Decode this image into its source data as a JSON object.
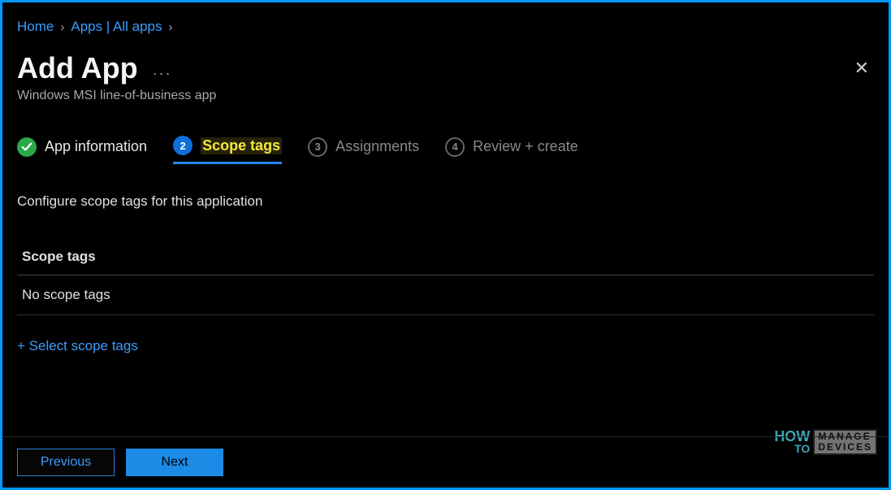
{
  "breadcrumb": {
    "home": "Home",
    "apps": "Apps | All apps"
  },
  "page": {
    "title": "Add App",
    "subtitle": "Windows MSI line-of-business app"
  },
  "steps": {
    "s1": {
      "label": "App information"
    },
    "s2": {
      "num": "2",
      "label": "Scope tags"
    },
    "s3": {
      "num": "3",
      "label": "Assignments"
    },
    "s4": {
      "num": "4",
      "label": "Review + create"
    }
  },
  "section": {
    "description": "Configure scope tags for this application",
    "header": "Scope tags",
    "empty_row": "No scope tags",
    "select_link": "+ Select scope tags"
  },
  "buttons": {
    "previous": "Previous",
    "next": "Next"
  },
  "watermark": {
    "how": "HOW",
    "to": "TO",
    "manage": "MANAGE",
    "devices": "DEVICES"
  }
}
